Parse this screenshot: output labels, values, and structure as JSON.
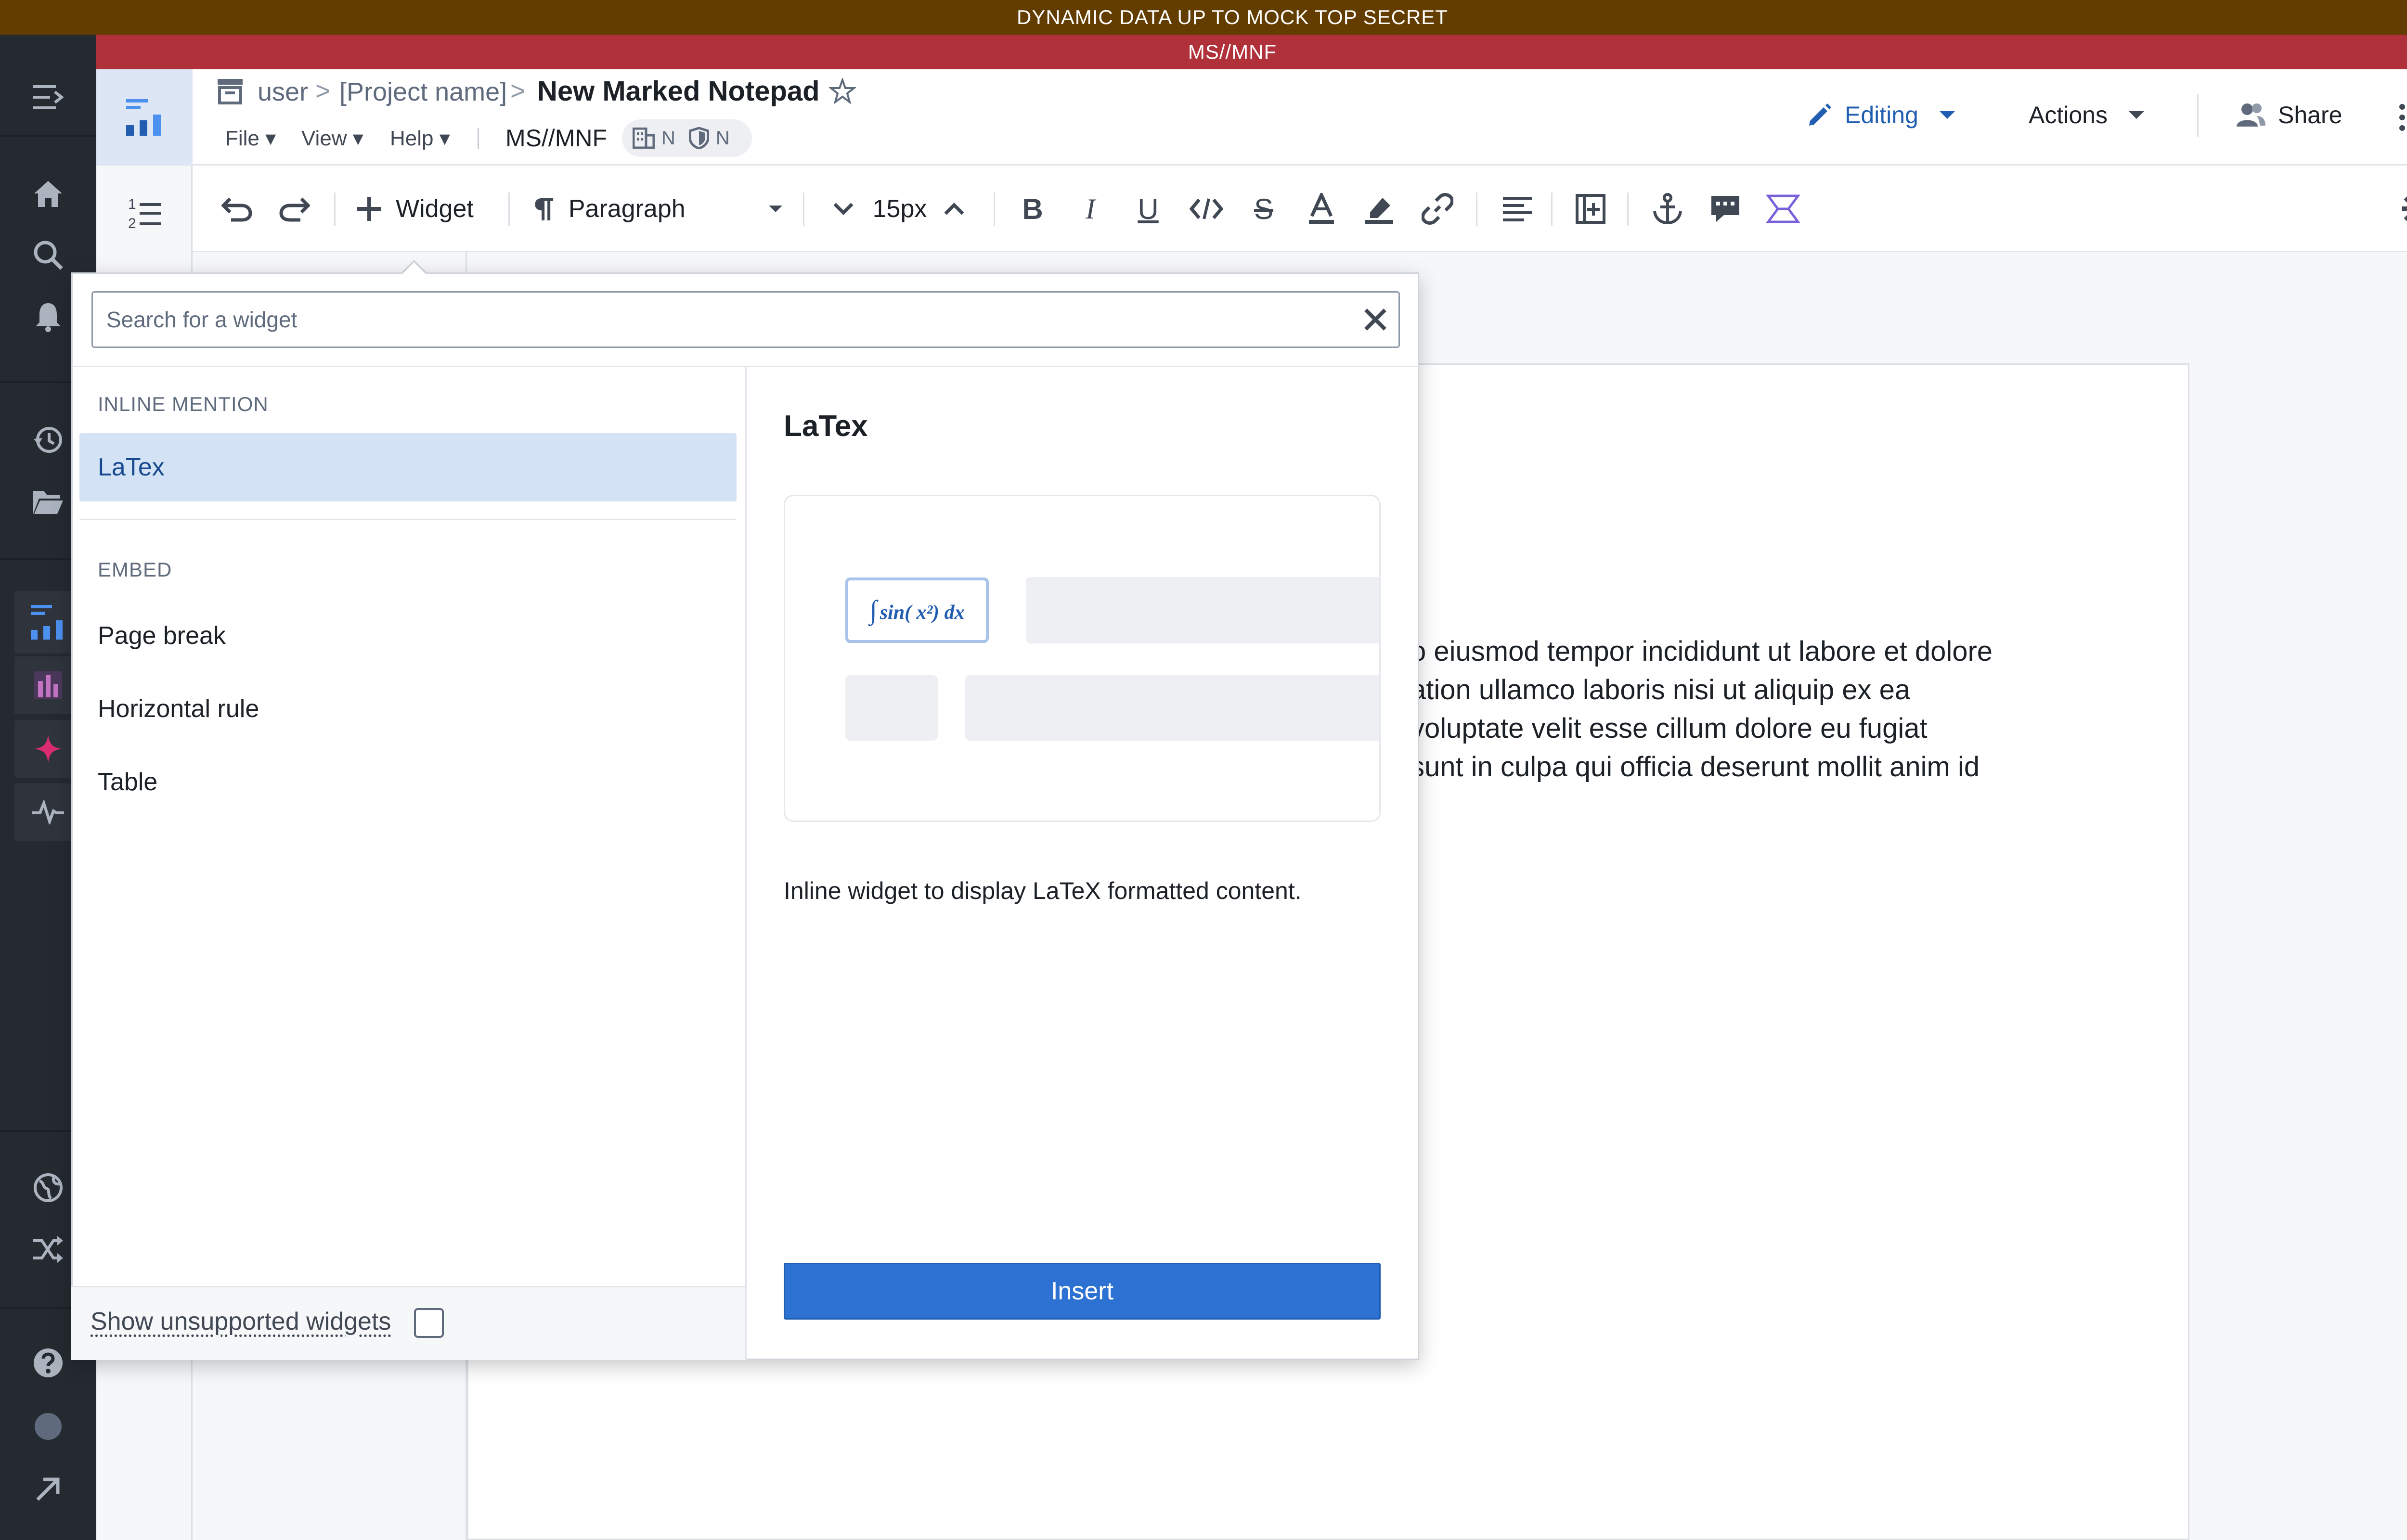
{
  "banners": {
    "top": "DYNAMIC DATA UP TO MOCK TOP SECRET",
    "sub": "MS//MNF"
  },
  "header": {
    "breadcrumb": {
      "user": "user",
      "separator": ">",
      "project": "[Project name]",
      "title": "New Marked Notepad"
    },
    "menus": [
      "File ▾",
      "View ▾",
      "Help ▾"
    ],
    "marking": "MS//MNF",
    "marking_badges": [
      "N",
      "N"
    ],
    "editing_label": "Editing",
    "actions_label": "Actions",
    "share_label": "Share"
  },
  "toolbar": {
    "widget_label": "Widget",
    "paragraph_label": "Paragraph",
    "font_size": "15px"
  },
  "document": {
    "lines": [
      "o eiusmod tempor incididunt ut labore et dolore",
      "ation ullamco laboris nisi ut aliquip ex ea",
      "voluptate velit esse cillum dolore eu fugiat",
      " sunt in culpa qui officia deserunt mollit anim id"
    ]
  },
  "popover": {
    "search_placeholder": "Search for a widget",
    "sections": [
      {
        "label": "INLINE MENTION",
        "items": [
          "LaTex"
        ]
      },
      {
        "label": "EMBED",
        "items": [
          "Page break",
          "Horizontal rule",
          "Table"
        ]
      }
    ],
    "selected_item": "LaTex",
    "preview": {
      "title": "LaTex",
      "formula": "∫sin( x²) dx",
      "description": "Inline widget to display LaTeX formatted content."
    },
    "insert_label": "Insert",
    "footer_label": "Show unsupported widgets",
    "show_unsupported_checked": false
  },
  "colors": {
    "banner_top": "#633c00",
    "banner_sub": "#b0313a",
    "accent": "#2d72d2",
    "nav_bg": "#252a31",
    "selected_bg": "#d3e2f5"
  },
  "icons": {
    "nav": [
      "expand-menu-icon",
      "home-icon",
      "search-icon",
      "bell-icon",
      "history-icon",
      "folder-icon",
      "notepad-app-icon",
      "chart-app-icon",
      "sparkle-icon",
      "pulse-icon",
      "globe-icon",
      "shuffle-icon",
      "help-icon",
      "status-dot-icon",
      "arrow-up-right-icon"
    ]
  }
}
